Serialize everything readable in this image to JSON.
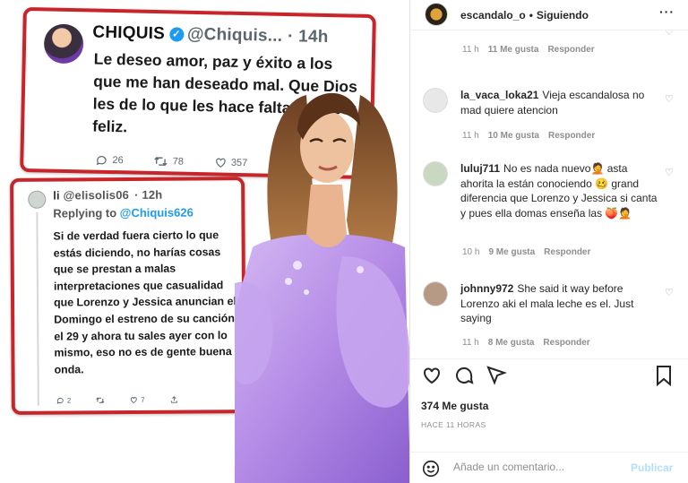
{
  "tweet_main": {
    "name": "CHIQUIS",
    "handle": "@Chiquis...",
    "time": "· 14h",
    "body": "Le deseo amor, paz y éxito a los que me han deseado mal. Que Dios les de lo que les hace falta para ser feliz.",
    "replies": "26",
    "retweets": "78",
    "likes": "357"
  },
  "tweet_reply": {
    "name": "li",
    "handle": "@elisolis06",
    "time": "· 12h",
    "replying_prefix": "Replying to ",
    "replying_to": "@Chiquis626",
    "body": "Si de verdad fuera cierto lo que estás diciendo, no harías cosas que se prestan a malas interpretaciones que casualidad que Lorenzo y Jessica anuncian el Domingo el estreno de su canción el 29 y ahora tu sales ayer con lo mismo, eso no es de gente buena onda.",
    "replies": "2",
    "likes": "7"
  },
  "header": {
    "username": "escandalo_o",
    "separator": "•",
    "follow_status": "Siguiendo",
    "more": "···"
  },
  "comments": [
    {
      "user": "",
      "text": "",
      "time": "11 h",
      "likes": "11 Me gusta",
      "reply": "Responder"
    },
    {
      "user": "la_vaca_loka21",
      "text": "Vieja escandalosa no mad quiere atencion",
      "time": "11 h",
      "likes": "10 Me gusta",
      "reply": "Responder"
    },
    {
      "user": "luluj711",
      "text": "No es nada nuevo🤦 asta ahorita la están conociendo 🥴 grand diferencia que Lorenzo y Jessica si canta y pues ella domas enseña las 🍑🤦",
      "time": "10 h",
      "likes": "9 Me gusta",
      "reply": "Responder"
    },
    {
      "user": "johnny972",
      "text": "She said it way before Lorenzo aki el mala leche es el. Just saying",
      "time": "11 h",
      "likes": "8 Me gusta",
      "reply": "Responder"
    }
  ],
  "likes_count": "374 Me gusta",
  "time_ago": "HACE 11 HORAS",
  "comment_box": {
    "placeholder": "Añade un comentario...",
    "publish": "Publicar"
  },
  "colors": {
    "card_border": "#c8252b",
    "twitter_blue": "#1d9bf0",
    "publish_disabled": "#b2dffc",
    "dress": "#b48ae6"
  }
}
